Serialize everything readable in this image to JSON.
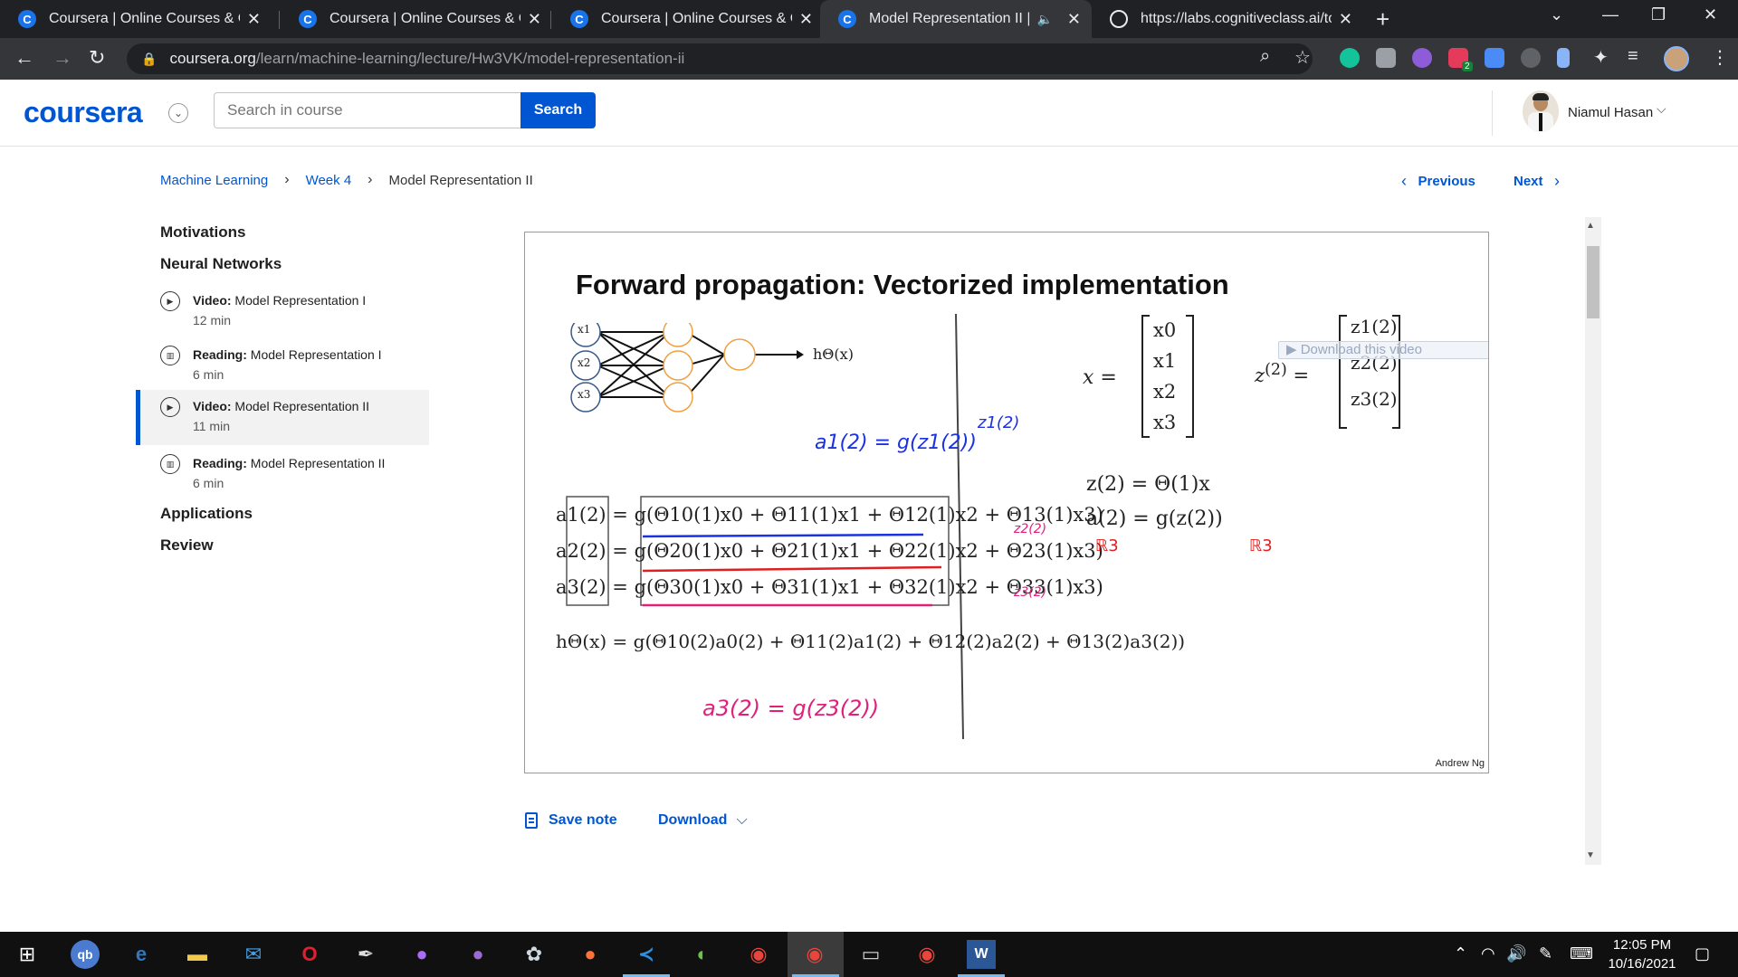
{
  "browser": {
    "tabs": [
      {
        "title": "Coursera | Online Courses & Credentials",
        "favicon": "coursera-icon",
        "active": false
      },
      {
        "title": "Coursera | Online Courses & Credentials",
        "favicon": "coursera-icon",
        "active": false
      },
      {
        "title": "Coursera | Online Courses & Credentials",
        "favicon": "coursera-icon",
        "active": false
      },
      {
        "title": "Model Representation II | Coursera",
        "favicon": "coursera-icon",
        "active": true,
        "audio": true
      },
      {
        "title": "https://labs.cognitiveclass.ai/tools",
        "favicon": "globe-icon",
        "active": false
      }
    ],
    "url_host": "coursera.org",
    "url_path": "/learn/machine-learning/lecture/Hw3VK/model-representation-ii",
    "extension_badge": "2"
  },
  "header": {
    "logo": "coursera",
    "search_placeholder": "Search in course",
    "search_button": "Search",
    "user_name": "Niamul Hasan"
  },
  "breadcrumb": {
    "items": [
      "Machine Learning",
      "Week 4",
      "Model Representation II"
    ]
  },
  "pager": {
    "previous": "Previous",
    "next": "Next"
  },
  "sidebar": {
    "sections": [
      "Motivations",
      "Neural Networks",
      "Applications",
      "Review"
    ],
    "items": [
      {
        "type": "Video:",
        "title": "Model Representation I",
        "duration": "12 min",
        "icon": "play-icon"
      },
      {
        "type": "Reading:",
        "title": "Model Representation I",
        "duration": "6 min",
        "icon": "book-icon"
      },
      {
        "type": "Video:",
        "title": "Model Representation II",
        "duration": "11 min",
        "icon": "play-icon",
        "active": true
      },
      {
        "type": "Reading:",
        "title": "Model Representation II",
        "duration": "6 min",
        "icon": "book-icon"
      }
    ]
  },
  "video": {
    "slide_title": "Forward propagation: Vectorized implementation",
    "author": "Andrew Ng",
    "overlay_text": "Download this video",
    "network_inputs": [
      "x1",
      "x2",
      "x3"
    ],
    "network_output": "hΘ(x)",
    "equations_left": [
      "a1(2) = g(Θ10(1)x0 + Θ11(1)x1 + Θ12(1)x2 + Θ13(1)x3)",
      "a2(2) = g(Θ20(1)x0 + Θ21(1)x1 + Θ22(1)x2 + Θ23(1)x3)",
      "a3(2) = g(Θ30(1)x0 + Θ31(1)x1 + Θ32(1)x2 + Θ33(1)x3)",
      "hΘ(x) = g(Θ10(2)a0(2) + Θ11(2)a1(2) + Θ12(2)a2(2) + Θ13(2)a3(2))"
    ],
    "x_vector": [
      "x0",
      "x1",
      "x2",
      "x3"
    ],
    "z_vector": [
      "z1(2)",
      "z2(2)",
      "z3(2)"
    ],
    "equations_right": [
      "z(2) = Θ(1)x",
      "a(2) = g(z(2))"
    ],
    "handwritten": [
      "a1(2) = g(z1(2))",
      "a3(2) = g(z3(2))",
      "z1(2)",
      "z2(2)",
      "z3(2)",
      "ℝ3",
      "ℝ3"
    ]
  },
  "actions": {
    "save_note": "Save note",
    "download": "Download"
  },
  "taskbar": {
    "time": "12:05 PM",
    "date": "10/16/2021",
    "apps": [
      "windows-start-icon",
      "quickbooks-icon",
      "edge-icon",
      "file-explorer-icon",
      "mail-icon",
      "opera-icon",
      "inkscape-icon",
      "messenger-icon",
      "github-icon",
      "paint-icon",
      "firefox-icon",
      "vscode-icon",
      "earth-icon",
      "chrome-icon",
      "chrome-active-icon",
      "terminal-icon",
      "chrome-profile-icon",
      "word-icon"
    ]
  },
  "colors": {
    "brand": "#0056d2",
    "annotation_blue": "#1a32e0",
    "annotation_pink": "#e0207a",
    "annotation_red": "#e02020",
    "node_orange": "#f0a040"
  }
}
